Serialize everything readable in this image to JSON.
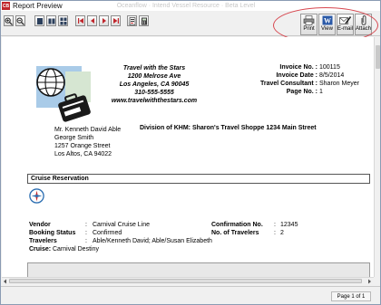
{
  "window": {
    "title": "Report Preview",
    "ghost_text": "Oceanflow · Intend Vessel Resource · Beta Level"
  },
  "toolbar": {
    "print": "Print",
    "view": "View",
    "email": "E-mail",
    "attach": "Attach"
  },
  "company": {
    "name": "Travel with the Stars",
    "street": "1200 Melrose Ave",
    "city": "Los Angeles, CA 90045",
    "phone": "310-555-5555",
    "web": "www.travelwiththestars.com"
  },
  "invoice": {
    "no_label": "Invoice No. :",
    "no": "100115",
    "date_label": "Invoice Date :",
    "date": "8/5/2014",
    "consultant_label": "Travel Consultant :",
    "consultant": "Sharon Meyer",
    "page_label": "Page No. :",
    "page": "1"
  },
  "division": "Division of KHM: Sharon's Travel Shoppe 1234 Main Street",
  "recipient": {
    "line1": "Mr. Kenneth David Able",
    "line2": "George Smith",
    "line3": "1257 Orange Street",
    "line4": "Los Altos, CA 94022"
  },
  "section": {
    "title": "Cruise Reservation"
  },
  "reservation": {
    "vendor_label": "Vendor",
    "vendor": "Carnival Cruise Line",
    "booking_label": "Booking Status",
    "booking": "Confirmed",
    "travelers_label": "Travelers",
    "travelers": "Able/Kenneth David; Able/Susan Elizabeth",
    "cruise_label": "Cruise:",
    "cruise": "Carnival Destiny",
    "confirmation_label": "Confirmation No.",
    "confirmation": "12345",
    "num_travelers_label": "No. of Travelers",
    "num_travelers": "2",
    "colon": ":"
  },
  "status": {
    "pager": "Page 1 of 1"
  }
}
